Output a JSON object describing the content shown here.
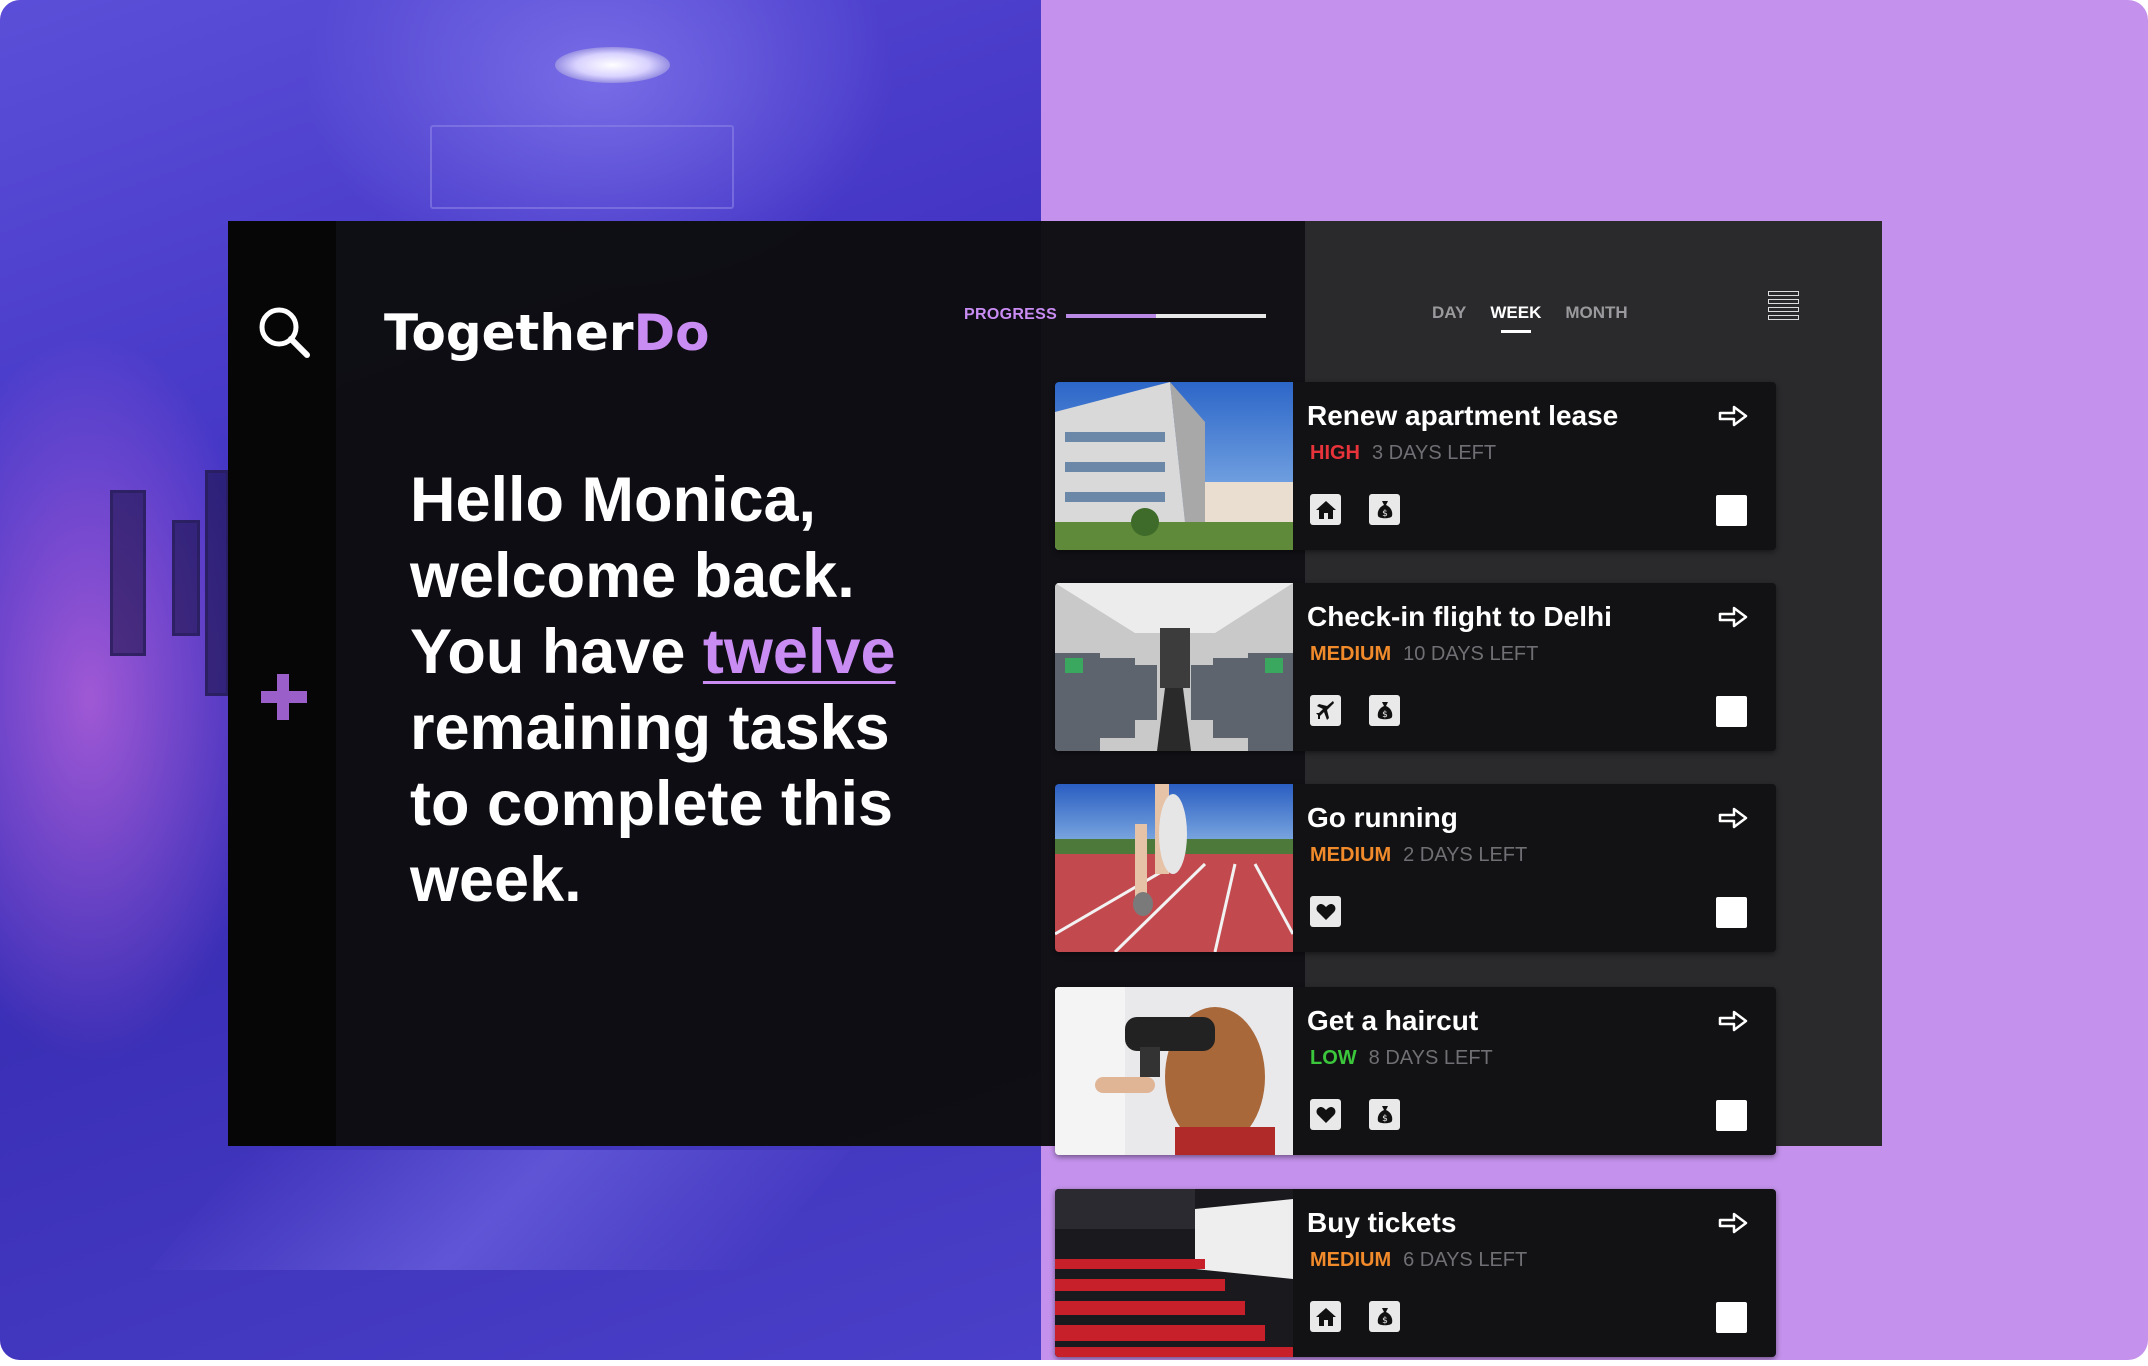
{
  "app": {
    "logo_part1": "Together",
    "logo_part2": "Do",
    "accent_color": "#c98cf2"
  },
  "progress": {
    "label": "PROGRESS",
    "value": 0.45
  },
  "greeting": {
    "line_prefix": "Hello Monica, welcome back. You have ",
    "highlight": "twelve",
    "line_suffix": " remaining tasks to complete  this week."
  },
  "view_tabs": [
    {
      "label": "DAY",
      "active": false
    },
    {
      "label": "WEEK",
      "active": true
    },
    {
      "label": "MONTH",
      "active": false
    }
  ],
  "icons": {
    "search": "search-icon",
    "add": "plus-icon",
    "menu": "menu-icon",
    "open": "arrow-right-icon"
  },
  "tasks": [
    {
      "title": "Renew apartment lease",
      "priority": "HIGH",
      "priority_color": "#e8333a",
      "days_left": "3 DAYS LEFT",
      "categories": [
        "home-icon",
        "money-bag-icon"
      ],
      "thumbnail": "apartment building"
    },
    {
      "title": "Check-in flight to Delhi",
      "priority": "MEDIUM",
      "priority_color": "#f08a2a",
      "days_left": "10 DAYS LEFT",
      "categories": [
        "airplane-icon",
        "money-bag-icon"
      ],
      "thumbnail": "airplane cabin"
    },
    {
      "title": "Go running",
      "priority": "MEDIUM",
      "priority_color": "#f08a2a",
      "days_left": "2 DAYS LEFT",
      "categories": [
        "heart-icon"
      ],
      "thumbnail": "running track"
    },
    {
      "title": "Get a haircut",
      "priority": "LOW",
      "priority_color": "#3bc63b",
      "days_left": "8 DAYS LEFT",
      "categories": [
        "heart-icon",
        "money-bag-icon"
      ],
      "thumbnail": "hair salon"
    },
    {
      "title": "Buy tickets",
      "priority": "MEDIUM",
      "priority_color": "#f08a2a",
      "days_left": "6 DAYS LEFT",
      "categories": [
        "home-icon",
        "money-bag-icon"
      ],
      "thumbnail": "cinema seats"
    }
  ]
}
